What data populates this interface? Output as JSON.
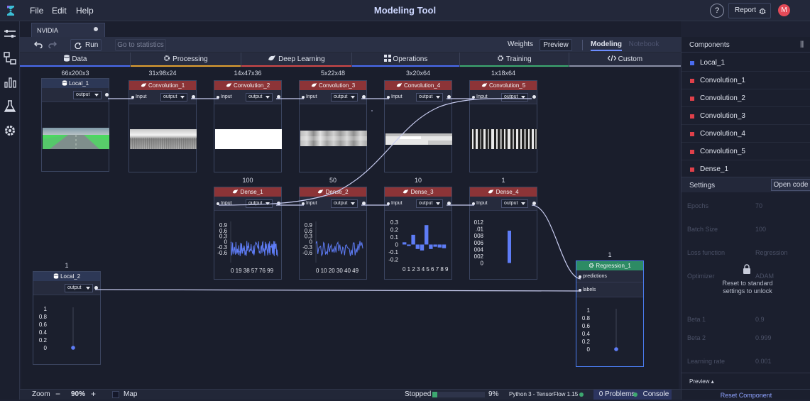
{
  "menu": {
    "file": "File",
    "edit": "Edit",
    "help": "Help"
  },
  "app_title": "Modeling Tool",
  "header": {
    "help": "?",
    "report": "Report",
    "avatar": "M"
  },
  "tab": {
    "name": "NVIDIA"
  },
  "toolbar": {
    "run": "Run",
    "stats": "Go to statistics",
    "weights": "Weights",
    "preview": "Preview",
    "modeling": "Modeling",
    "notebook": "Notebook"
  },
  "categories": [
    {
      "label": "Data",
      "icon": "database-icon",
      "color": "#4a6cf0"
    },
    {
      "label": "Processing",
      "icon": "gear-icon",
      "color": "#e0a030"
    },
    {
      "label": "Deep Learning",
      "icon": "brain-icon",
      "color": "#d04848"
    },
    {
      "label": "Operations",
      "icon": "grid-icon",
      "color": "#4a6cf0"
    },
    {
      "label": "Training",
      "icon": "gear-icon",
      "color": "#3da870"
    },
    {
      "label": "Custom",
      "icon": "code-icon",
      "color": "#8a8fa6"
    }
  ],
  "nodes": {
    "local1": {
      "name": "Local_1",
      "size": "66x200x3",
      "out": "output"
    },
    "conv1": {
      "name": "Convolution_1",
      "size": "31x98x24",
      "in": "Input",
      "out": "output"
    },
    "conv2": {
      "name": "Convolution_2",
      "size": "14x47x36",
      "in": "Input",
      "out": "output"
    },
    "conv3": {
      "name": "Convolution_3",
      "size": "5x22x48",
      "in": "Input",
      "out": "output"
    },
    "conv4": {
      "name": "Convolution_4",
      "size": "3x20x64",
      "in": "Input",
      "out": "output"
    },
    "conv5": {
      "name": "Convolution_5",
      "size": "1x18x64",
      "in": "Input",
      "out": "output"
    },
    "dense1": {
      "name": "Dense_1",
      "size": "100",
      "in": "Input",
      "out": "output"
    },
    "dense2": {
      "name": "Dense_2",
      "size": "50",
      "in": "Input",
      "out": "output"
    },
    "dense3": {
      "name": "Dense_3",
      "size": "10",
      "in": "Input",
      "out": "output"
    },
    "dense4": {
      "name": "Dense_4",
      "size": "1",
      "in": "Input",
      "out": "output"
    },
    "local2": {
      "name": "Local_2",
      "size": "1",
      "out": "output"
    },
    "reg1": {
      "name": "Regression_1",
      "size": "1",
      "in1": "predictions",
      "in2": "labels"
    }
  },
  "charts": {
    "dense1": {
      "yticks": [
        "0.9",
        "0.6",
        "0.3",
        "0",
        "-0.3",
        "-0.6"
      ],
      "xticks": "0  19 38 57 76  99"
    },
    "dense2": {
      "yticks": [
        "0.9",
        "0.6",
        "0.3",
        "0",
        "-0.3",
        "-0.6"
      ],
      "xticks": "0  10 20 30 40 49"
    },
    "dense3": {
      "yticks": [
        "0.3",
        "0.2",
        "0.1",
        "0",
        "-0.1",
        "-0.2"
      ],
      "xticks": "0 1 2 3 4 5 6 7 8 9",
      "values": [
        0.03,
        -0.02,
        0.13,
        -0.06,
        -0.08,
        0.26,
        -0.06,
        -0.03,
        -0.04,
        -0.05
      ]
    },
    "dense4": {
      "yticks": [
        "012",
        ".01",
        "008",
        "006",
        "004",
        "002",
        "0"
      ],
      "values": [
        0.0095
      ]
    },
    "local2": {
      "yticks": [
        "1",
        "0.8",
        "0.6",
        "0.4",
        "0.2",
        "0"
      ],
      "values": [
        0
      ]
    },
    "reg1": {
      "yticks": [
        "1",
        "0.8",
        "0.6",
        "0.4",
        "0.2",
        "0"
      ],
      "values": [
        0
      ]
    }
  },
  "components_panel": {
    "title": "Components",
    "items": [
      {
        "name": "Local_1",
        "color": "#4a6cf0"
      },
      {
        "name": "Convolution_1",
        "color": "#e0404a"
      },
      {
        "name": "Convolution_2",
        "color": "#e0404a"
      },
      {
        "name": "Convolution_3",
        "color": "#e0404a"
      },
      {
        "name": "Convolution_4",
        "color": "#e0404a"
      },
      {
        "name": "Convolution_5",
        "color": "#e0404a"
      },
      {
        "name": "Dense_1",
        "color": "#e0404a"
      }
    ]
  },
  "settings": {
    "title": "Settings",
    "open_code": "Open code",
    "rows": [
      {
        "label": "Epochs",
        "value": "70"
      },
      {
        "label": "Batch Size",
        "value": "100"
      },
      {
        "label": "Loss function",
        "value": "Regression"
      },
      {
        "label": "Optimizer",
        "value": "ADAM"
      },
      {
        "label": "Beta 1",
        "value": "0.9"
      },
      {
        "label": "Beta 2",
        "value": "0.999"
      },
      {
        "label": "Learning rate",
        "value": "0.001"
      }
    ],
    "lock_line1": "Reset to standard",
    "lock_line2": "settings to unlock",
    "preview": "Preview",
    "reset": "Reset Component"
  },
  "status": {
    "zoom_label": "Zoom",
    "zoom_value": "90%",
    "map": "Map",
    "state": "Stopped",
    "percent": "9%",
    "progress": 0.09,
    "runtime": "Python 3 - TensorFlow 1.15",
    "problems": "0 Problems",
    "console": "Console"
  }
}
